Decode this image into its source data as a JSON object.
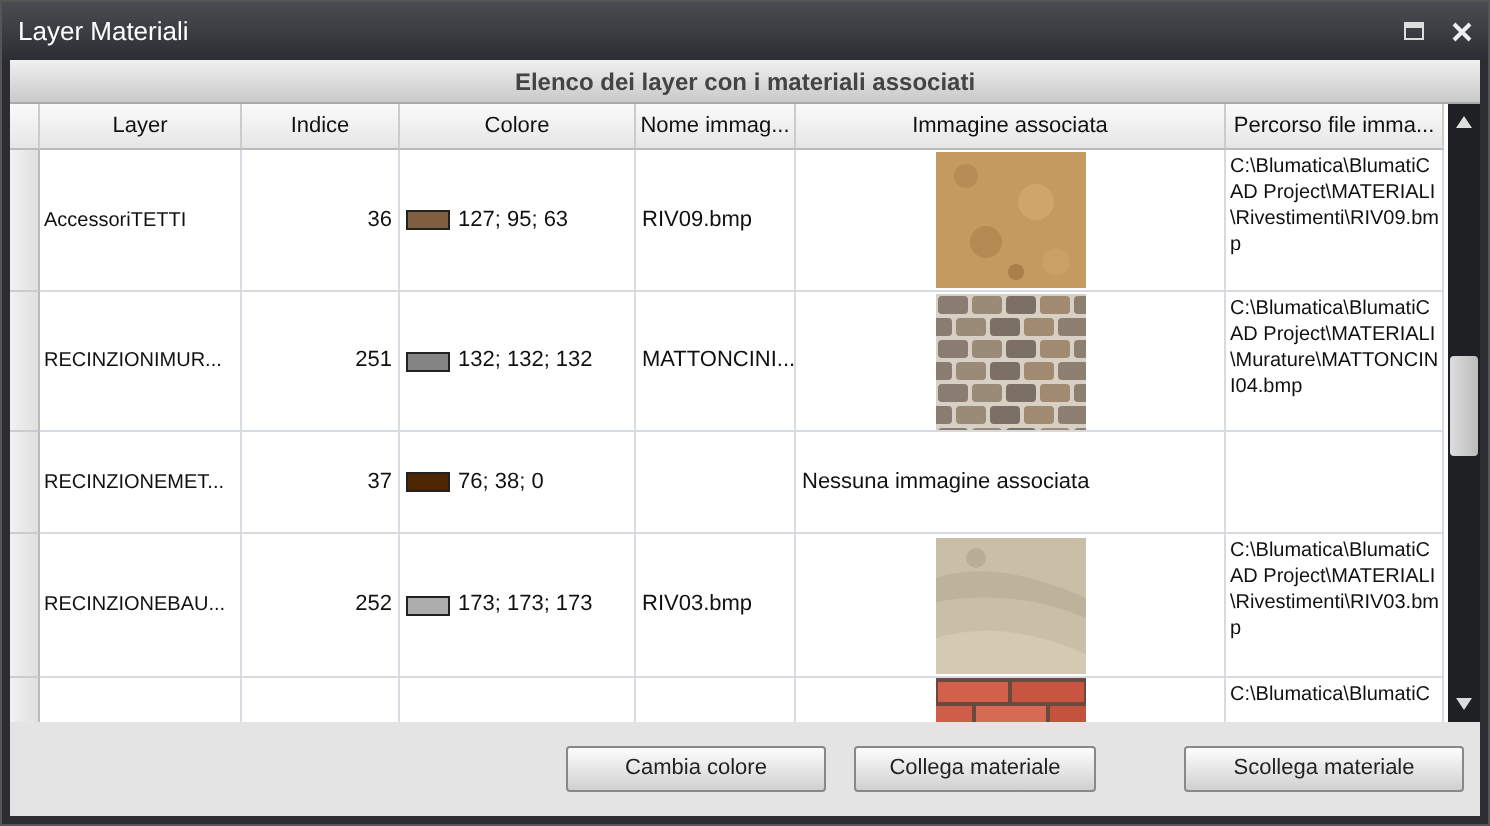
{
  "window": {
    "title": "Layer Materiali"
  },
  "grid_title": "Elenco dei layer con i materiali associati",
  "columns": [
    "Layer",
    "Indice",
    "Colore",
    "Nome immag...",
    "Immagine associata",
    "Percorso file imma..."
  ],
  "rows": [
    {
      "layer": "AccessoriTETTI",
      "index": "36",
      "color": "#7f5f3f",
      "color_text": "127; 95; 63",
      "image_name": "RIV09.bmp",
      "path": "C:\\Blumatica\\BlumatiCAD Project\\MATERIALI\\Rivestimenti\\RIV09.bmp"
    },
    {
      "layer": "RECINZIONIMUR...",
      "index": "251",
      "color": "#848484",
      "color_text": "132; 132; 132",
      "image_name": "MATTONCINI...",
      "path": "C:\\Blumatica\\BlumatiCAD Project\\MATERIALI\\Murature\\MATTONCINI04.bmp"
    },
    {
      "layer": "RECINZIONEMET...",
      "index": "37",
      "color": "#4c2600",
      "color_text": "76; 38; 0",
      "image": {
        "kind": "text",
        "text": "Nessuna immagine associata"
      }
    },
    {
      "layer": "RECINZIONEBAU...",
      "index": "252",
      "color": "#adadad",
      "color_text": "173; 173; 173",
      "image_name": "RIV03.bmp",
      "path": "C:\\Blumatica\\BlumatiCAD Project\\MATERIALI\\Rivestimenti\\RIV03.bmp"
    },
    {
      "path": "C:\\Blumatica\\BlumatiC"
    }
  ],
  "buttons": [
    "Cambia colore",
    "Collega materiale",
    "Scollega materiale"
  ]
}
